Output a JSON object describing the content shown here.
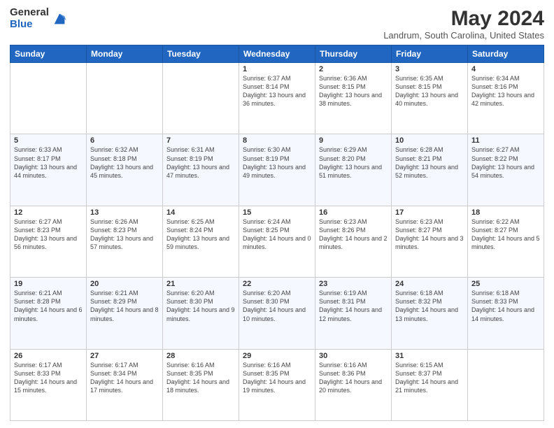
{
  "header": {
    "logo_general": "General",
    "logo_blue": "Blue",
    "title": "May 2024",
    "location": "Landrum, South Carolina, United States"
  },
  "days_of_week": [
    "Sunday",
    "Monday",
    "Tuesday",
    "Wednesday",
    "Thursday",
    "Friday",
    "Saturday"
  ],
  "weeks": [
    [
      {
        "day": "",
        "info": ""
      },
      {
        "day": "",
        "info": ""
      },
      {
        "day": "",
        "info": ""
      },
      {
        "day": "1",
        "info": "Sunrise: 6:37 AM\nSunset: 8:14 PM\nDaylight: 13 hours\nand 36 minutes."
      },
      {
        "day": "2",
        "info": "Sunrise: 6:36 AM\nSunset: 8:15 PM\nDaylight: 13 hours\nand 38 minutes."
      },
      {
        "day": "3",
        "info": "Sunrise: 6:35 AM\nSunset: 8:15 PM\nDaylight: 13 hours\nand 40 minutes."
      },
      {
        "day": "4",
        "info": "Sunrise: 6:34 AM\nSunset: 8:16 PM\nDaylight: 13 hours\nand 42 minutes."
      }
    ],
    [
      {
        "day": "5",
        "info": "Sunrise: 6:33 AM\nSunset: 8:17 PM\nDaylight: 13 hours\nand 44 minutes."
      },
      {
        "day": "6",
        "info": "Sunrise: 6:32 AM\nSunset: 8:18 PM\nDaylight: 13 hours\nand 45 minutes."
      },
      {
        "day": "7",
        "info": "Sunrise: 6:31 AM\nSunset: 8:19 PM\nDaylight: 13 hours\nand 47 minutes."
      },
      {
        "day": "8",
        "info": "Sunrise: 6:30 AM\nSunset: 8:19 PM\nDaylight: 13 hours\nand 49 minutes."
      },
      {
        "day": "9",
        "info": "Sunrise: 6:29 AM\nSunset: 8:20 PM\nDaylight: 13 hours\nand 51 minutes."
      },
      {
        "day": "10",
        "info": "Sunrise: 6:28 AM\nSunset: 8:21 PM\nDaylight: 13 hours\nand 52 minutes."
      },
      {
        "day": "11",
        "info": "Sunrise: 6:27 AM\nSunset: 8:22 PM\nDaylight: 13 hours\nand 54 minutes."
      }
    ],
    [
      {
        "day": "12",
        "info": "Sunrise: 6:27 AM\nSunset: 8:23 PM\nDaylight: 13 hours\nand 56 minutes."
      },
      {
        "day": "13",
        "info": "Sunrise: 6:26 AM\nSunset: 8:23 PM\nDaylight: 13 hours\nand 57 minutes."
      },
      {
        "day": "14",
        "info": "Sunrise: 6:25 AM\nSunset: 8:24 PM\nDaylight: 13 hours\nand 59 minutes."
      },
      {
        "day": "15",
        "info": "Sunrise: 6:24 AM\nSunset: 8:25 PM\nDaylight: 14 hours\nand 0 minutes."
      },
      {
        "day": "16",
        "info": "Sunrise: 6:23 AM\nSunset: 8:26 PM\nDaylight: 14 hours\nand 2 minutes."
      },
      {
        "day": "17",
        "info": "Sunrise: 6:23 AM\nSunset: 8:27 PM\nDaylight: 14 hours\nand 3 minutes."
      },
      {
        "day": "18",
        "info": "Sunrise: 6:22 AM\nSunset: 8:27 PM\nDaylight: 14 hours\nand 5 minutes."
      }
    ],
    [
      {
        "day": "19",
        "info": "Sunrise: 6:21 AM\nSunset: 8:28 PM\nDaylight: 14 hours\nand 6 minutes."
      },
      {
        "day": "20",
        "info": "Sunrise: 6:21 AM\nSunset: 8:29 PM\nDaylight: 14 hours\nand 8 minutes."
      },
      {
        "day": "21",
        "info": "Sunrise: 6:20 AM\nSunset: 8:30 PM\nDaylight: 14 hours\nand 9 minutes."
      },
      {
        "day": "22",
        "info": "Sunrise: 6:20 AM\nSunset: 8:30 PM\nDaylight: 14 hours\nand 10 minutes."
      },
      {
        "day": "23",
        "info": "Sunrise: 6:19 AM\nSunset: 8:31 PM\nDaylight: 14 hours\nand 12 minutes."
      },
      {
        "day": "24",
        "info": "Sunrise: 6:18 AM\nSunset: 8:32 PM\nDaylight: 14 hours\nand 13 minutes."
      },
      {
        "day": "25",
        "info": "Sunrise: 6:18 AM\nSunset: 8:33 PM\nDaylight: 14 hours\nand 14 minutes."
      }
    ],
    [
      {
        "day": "26",
        "info": "Sunrise: 6:17 AM\nSunset: 8:33 PM\nDaylight: 14 hours\nand 15 minutes."
      },
      {
        "day": "27",
        "info": "Sunrise: 6:17 AM\nSunset: 8:34 PM\nDaylight: 14 hours\nand 17 minutes."
      },
      {
        "day": "28",
        "info": "Sunrise: 6:16 AM\nSunset: 8:35 PM\nDaylight: 14 hours\nand 18 minutes."
      },
      {
        "day": "29",
        "info": "Sunrise: 6:16 AM\nSunset: 8:35 PM\nDaylight: 14 hours\nand 19 minutes."
      },
      {
        "day": "30",
        "info": "Sunrise: 6:16 AM\nSunset: 8:36 PM\nDaylight: 14 hours\nand 20 minutes."
      },
      {
        "day": "31",
        "info": "Sunrise: 6:15 AM\nSunset: 8:37 PM\nDaylight: 14 hours\nand 21 minutes."
      },
      {
        "day": "",
        "info": ""
      }
    ]
  ]
}
